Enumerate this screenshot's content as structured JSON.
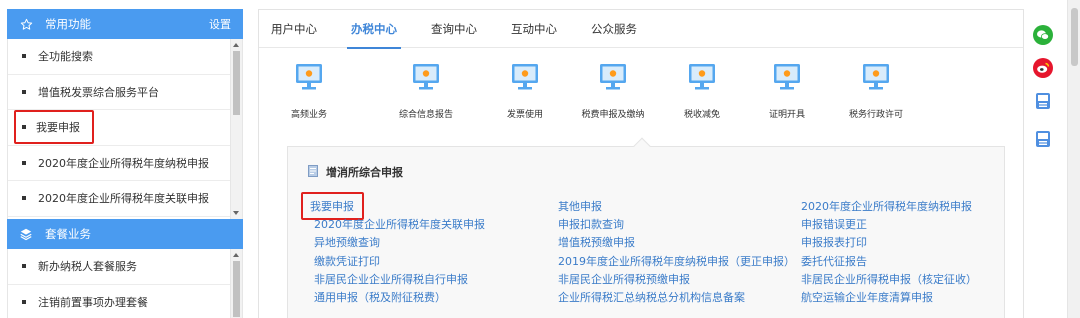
{
  "sidebar": {
    "common": {
      "title": "常用功能",
      "settings_label": "设置",
      "items": [
        {
          "label": "全功能搜索"
        },
        {
          "label": "增值税发票综合服务平台"
        },
        {
          "label": "我要申报"
        },
        {
          "label": "2020年度企业所得税年度纳税申报"
        },
        {
          "label": "2020年度企业所得税年度关联申报"
        }
      ]
    },
    "packages": {
      "title": "套餐业务",
      "items": [
        {
          "label": "新办纳税人套餐服务"
        },
        {
          "label": "注销前置事项办理套餐"
        }
      ]
    }
  },
  "tabs": [
    {
      "label": "用户中心"
    },
    {
      "label": "办税中心"
    },
    {
      "label": "查询中心"
    },
    {
      "label": "互动中心"
    },
    {
      "label": "公众服务"
    }
  ],
  "functions": [
    {
      "label": "高频业务"
    },
    {
      "label": "综合信息报告"
    },
    {
      "label": "发票使用"
    },
    {
      "label": "税费申报及缴纳"
    },
    {
      "label": "税收减免"
    },
    {
      "label": "证明开具"
    },
    {
      "label": "税务行政许可"
    }
  ],
  "sub_panel": {
    "title": "增消所综合申报",
    "links": [
      [
        "我要申报",
        "其他申报",
        "2020年度企业所得税年度纳税申报"
      ],
      [
        "2020年度企业所得税年度关联申报",
        "申报扣款查询",
        "申报错误更正"
      ],
      [
        "异地预缴查询",
        "增值税预缴申报",
        "申报报表打印"
      ],
      [
        "缴款凭证打印",
        "2019年度企业所得税年度纳税申报（更正申报）",
        "委托代征报告"
      ],
      [
        "非居民企业企业所得税自行申报",
        "非居民企业所得税预缴申报",
        "非居民企业所得税申报（核定征收）"
      ],
      [
        "通用申报（税及附征税费）",
        "企业所得税汇总纳税总分机构信息备案",
        "航空运输企业年度清算申报"
      ]
    ]
  },
  "colors": {
    "accent": "#4a9bf0",
    "active_tab": "#3f86d8",
    "link": "#3b7cc9",
    "highlight": "#e0201d"
  },
  "icons": [
    "star-icon",
    "layers-icon",
    "monitor-icon",
    "document-icon",
    "wechat-icon",
    "weibo-icon",
    "app-icon"
  ]
}
